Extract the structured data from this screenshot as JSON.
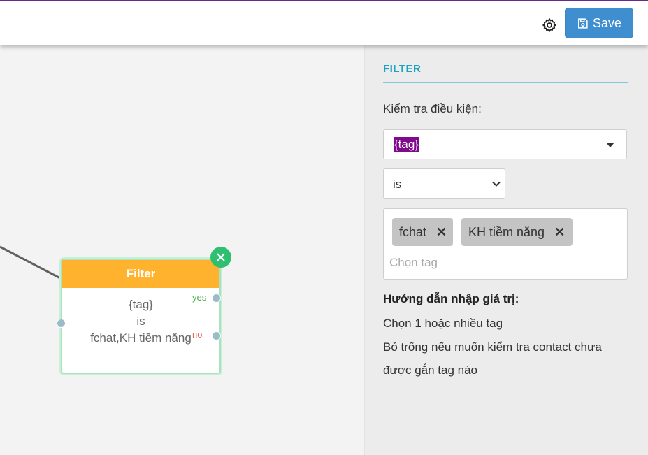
{
  "toolbar": {
    "settings_icon": "gear-icon",
    "save_icon": "save-icon",
    "save_label": "Save",
    "save_color": "#3e8ed0"
  },
  "canvas": {
    "node": {
      "title": "Filter",
      "header_color": "#ffb22e",
      "line1": "{tag}",
      "line2": "is",
      "line3": "fchat,KH tiềm năng",
      "yes_label": "yes",
      "no_label": "no",
      "close_icon": "close-icon"
    }
  },
  "panel": {
    "title": "FILTER",
    "condition_label": "Kiểm tra điều kiện:",
    "field_value": "{tag}",
    "operator_value": "is",
    "tags": [
      "fchat",
      "KH tiềm năng"
    ],
    "tags_placeholder": "Chọn tag",
    "guide_title": "Hướng dẫn nhập giá trị:",
    "guide_lines": [
      "Chọn 1 hoặc nhiều tag",
      "Bỏ trống nếu muốn kiểm tra contact chưa",
      "được gắn tag nào"
    ],
    "accent_color": "#1ba2c2"
  }
}
